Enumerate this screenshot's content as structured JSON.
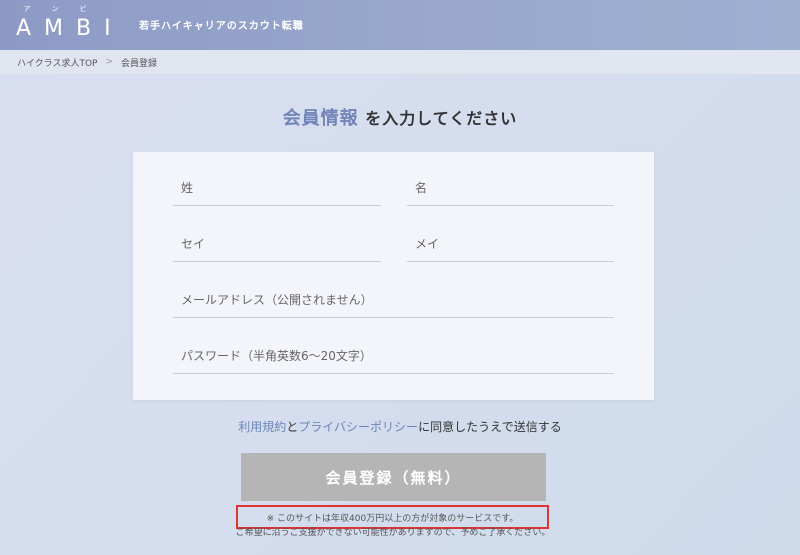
{
  "header": {
    "logo": "AMBI",
    "logo_ruby": [
      "ア",
      "ン",
      "ビ"
    ],
    "tagline": "若手ハイキャリアのスカウト転職"
  },
  "breadcrumb": {
    "home": "ハイクラス求人TOP",
    "separator": ">",
    "current": "会員登録"
  },
  "page": {
    "title_accent": "会員情報",
    "title_rest": "を入力してください"
  },
  "form": {
    "last_name_placeholder": "姓",
    "first_name_placeholder": "名",
    "last_name_kana_placeholder": "セイ",
    "first_name_kana_placeholder": "メイ",
    "email_placeholder": "メールアドレス（公開されません）",
    "password_placeholder": "パスワード（半角英数6～20文字）"
  },
  "agreement": {
    "terms_link": "利用規約",
    "and": "と",
    "privacy_link": "プライバシーポリシー",
    "rest": "に同意したうえで送信する"
  },
  "submit_label": "会員登録（無料）",
  "notice": "※ このサイトは年収400万円以上の方が対象のサービスです。",
  "notice2": "ご希望に沿うご支援ができない可能性がありますので、予めご了承ください。",
  "colors": {
    "accent": "#7384b8",
    "header": "#8d9ac6",
    "submit_disabled": "#b5b5b5",
    "notice_border": "#e03333"
  }
}
